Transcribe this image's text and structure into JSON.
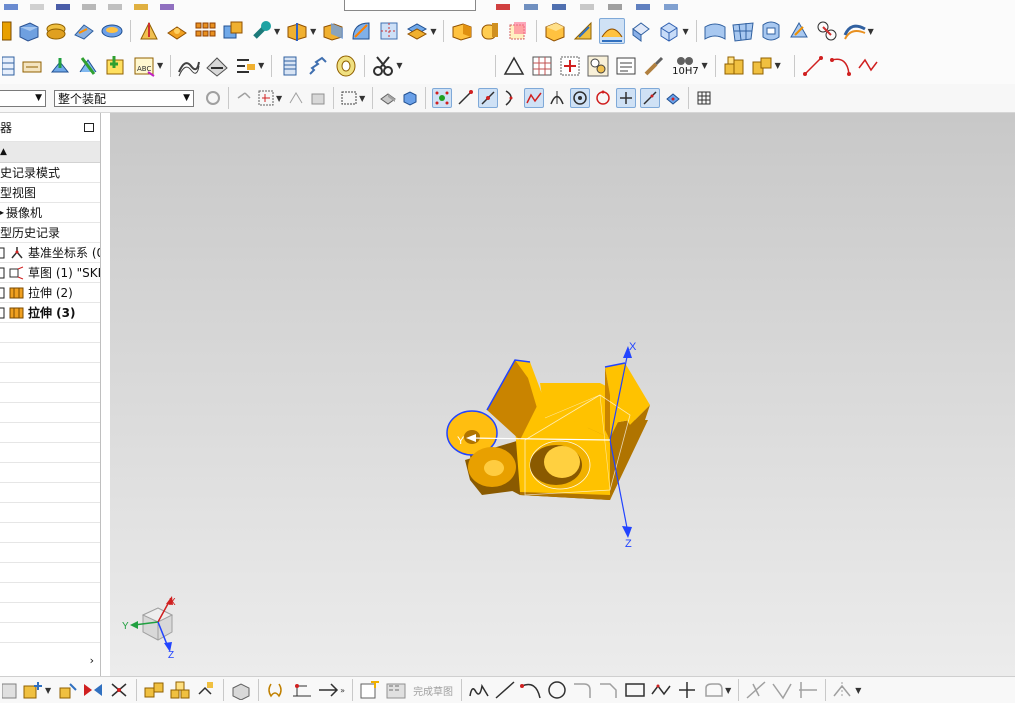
{
  "toolbar": {
    "row4": {
      "selection_filter_value": "",
      "selection_scope_value": "整个装配"
    }
  },
  "navigator": {
    "title": "器",
    "column_header": "▲",
    "items": [
      {
        "label": "史记录模式"
      },
      {
        "label": "型视图"
      },
      {
        "label": "摄像机"
      },
      {
        "label": "型历史记录"
      },
      {
        "label": "基准坐标系 (0"
      },
      {
        "label": "草图 (1) \"SKE"
      },
      {
        "label": "拉伸 (2)"
      },
      {
        "label": "拉伸 (3)"
      }
    ]
  },
  "viewport": {
    "axis_x": "X",
    "axis_y": "Y",
    "axis_z": "Z",
    "triad_x": "X",
    "triad_y": "Y",
    "triad_z": "Z"
  },
  "toolbar_row3": {
    "tolerance_label": "10H7"
  },
  "bottombar": {
    "finish_sketch_label": "完成草图"
  },
  "colors": {
    "part_light": "#ffc200",
    "part_mid": "#e8a000",
    "part_dark": "#8a5a00",
    "edge_highlight": "#2244ff"
  }
}
